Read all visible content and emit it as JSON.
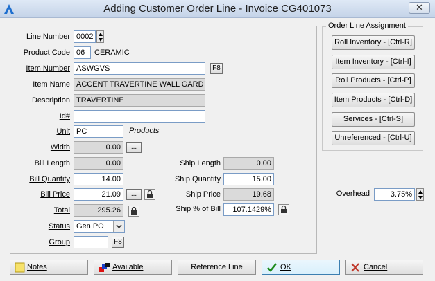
{
  "window": {
    "title": "Adding Customer Order Line - Invoice CG401073",
    "close": "✕"
  },
  "form": {
    "line_number": {
      "label": "Line Number",
      "value": "0002"
    },
    "product_code": {
      "label": "Product Code",
      "value": "06",
      "text": "CERAMIC"
    },
    "item_number": {
      "label": "Item Number",
      "value": "ASWGVS",
      "button": "F8"
    },
    "item_name": {
      "label": "Item Name",
      "value": "ACCENT TRAVERTINE WALL GARD"
    },
    "description": {
      "label": "Description",
      "value": "TRAVERTINE"
    },
    "id_number": {
      "label": "Id#",
      "value": ""
    },
    "unit": {
      "label": "Unit",
      "value": "PC",
      "text": "Products"
    },
    "width": {
      "label": "Width",
      "value": "0.00",
      "button": "..."
    },
    "bill_length": {
      "label": "Bill Length",
      "value": "0.00"
    },
    "bill_quantity": {
      "label": "Bill Quantity",
      "value": "14.00"
    },
    "bill_price": {
      "label": "Bill Price",
      "value": "21.09",
      "button": "..."
    },
    "total": {
      "label": "Total",
      "value": "295.26"
    },
    "status": {
      "label": "Status",
      "value": "Gen PO"
    },
    "group": {
      "label": "Group",
      "value": "",
      "button": "F8"
    },
    "ship_length": {
      "label": "Ship Length",
      "value": "0.00"
    },
    "ship_quantity": {
      "label": "Ship Quantity",
      "value": "15.00"
    },
    "ship_price": {
      "label": "Ship Price",
      "value": "19.68"
    },
    "ship_pct_of_bill": {
      "label": "Ship % of Bill",
      "value": "107.1429%"
    }
  },
  "assignment": {
    "title": "Order Line Assignment",
    "buttons": [
      "Roll Inventory - [Ctrl-R]",
      "Item Inventory - [Ctrl-I]",
      "Roll Products - [Ctrl-P]",
      "Item Products - [Ctrl-D]",
      "Services - [Ctrl-S]",
      "Unreferenced - [Ctrl-U]"
    ]
  },
  "overhead": {
    "label": "Overhead",
    "value": "3.75%"
  },
  "bottom": {
    "notes": "Notes",
    "available": "Available",
    "reference_line": "Reference Line",
    "ok": "OK",
    "cancel": "Cancel"
  },
  "colors": {
    "accent": "#1e6fcf",
    "ok_check": "#1a8a1a",
    "cancel_x": "#c0392b"
  }
}
